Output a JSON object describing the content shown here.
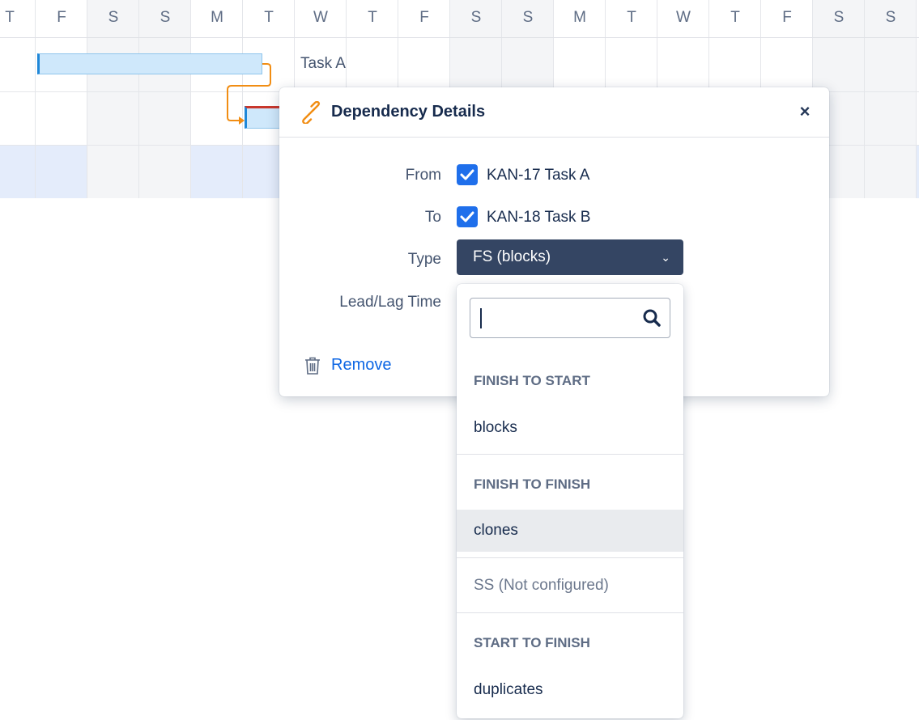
{
  "timeline": {
    "days": [
      "T",
      "F",
      "S",
      "S",
      "M",
      "T",
      "W",
      "T",
      "F",
      "S",
      "S",
      "M",
      "T",
      "W",
      "T",
      "F",
      "S",
      "S"
    ],
    "task_a_label": "Task A"
  },
  "dialog": {
    "title": "Dependency Details",
    "close": "×",
    "from_label": "From",
    "from_value": "KAN-17 Task A",
    "to_label": "To",
    "to_value": "KAN-18 Task B",
    "type_label": "Type",
    "type_value": "FS (blocks)",
    "type_chevron": "⌄",
    "lead_lag_label": "Lead/Lag Time",
    "remove_label": "Remove"
  },
  "type_menu": {
    "search_placeholder": "",
    "groups": [
      {
        "heading": "FINISH TO START",
        "options": [
          "blocks"
        ]
      },
      {
        "heading": "FINISH TO FINISH",
        "options": [
          "clones"
        ]
      },
      {
        "heading": "",
        "options": [
          "SS (Not configured)"
        ]
      },
      {
        "heading": "START TO FINISH",
        "options": [
          "duplicates"
        ]
      }
    ]
  },
  "colors": {
    "accent": "#1f6feb",
    "select_bg": "#344563",
    "link": "#0c66e4",
    "dependency_line": "#f18d13"
  }
}
